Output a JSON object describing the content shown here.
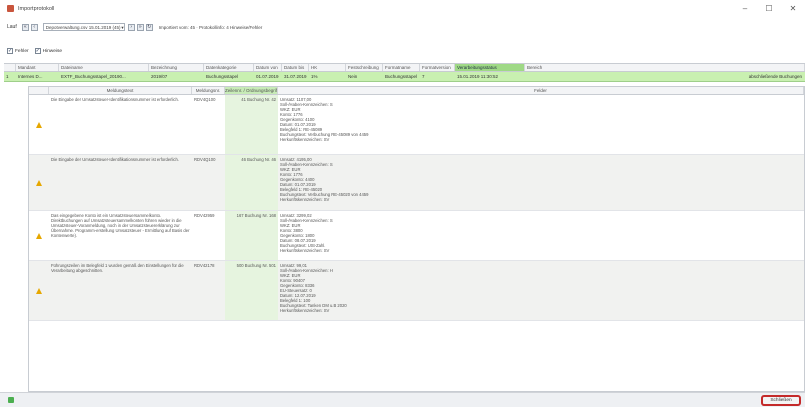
{
  "window": {
    "title": "Importprotokoll",
    "controls": [
      "–",
      "☐",
      "✕"
    ]
  },
  "toolbar": {
    "lauf_label": "Lauf",
    "lauf_value": "Depotverwaltung.csv 15.01.2019 (45)",
    "summary": "Importiert vom: 45 · Protokollinfo: 4 Hinweise/Fehler"
  },
  "filters": [
    {
      "label": "Fehler",
      "checked": true
    },
    {
      "label": "Hinweise",
      "checked": true
    }
  ],
  "grid": {
    "columns": [
      "",
      "Mandant",
      "Dateiname",
      "Bezeichnung",
      "Datenkategorie",
      "Datum von",
      "Datum bis",
      "HK",
      "Festschreibung",
      "Formatname",
      "Formatversion",
      "Verarbeitungsstatus",
      "Bereich"
    ],
    "row": {
      "warn": "1",
      "cells": [
        "Internes D...",
        "EXTF_Buchungsstapel_20190...",
        "2019/07",
        "Buchungsstapel",
        "01.07.2019",
        "31.07.2019",
        "1%",
        "Nein",
        "Buchungsstapel",
        "7",
        "15.01.2019 11:30:52"
      ],
      "bereich": "abschließende Buchungen"
    }
  },
  "detail": {
    "columns": [
      "",
      "Meldungstext",
      "Meldungsnr.",
      "Zeilennr. / Ordnungsbegriff",
      "Felder"
    ],
    "rows": [
      {
        "text": "Die Eingabe der Umsatzsteuer-Identifikationsnummer ist erforderlich.",
        "code": "RDV4Q100",
        "ref": "41  Buchung Nr. 42",
        "fields": "Umsatz: 1107,00\nSoll-/Haben-Kennzeichen: S\nWKZ: EUR\nKonto: 1776\nGegenkonto: 4100\nDatum: 01.07.2019\nBelegfeld 1: RE-45089\nBuchungstext: Verbuchung RE-45089 von 4459\nHerkunftskennzeichen: SV"
      },
      {
        "text": "Die Eingabe der Umsatzsteuer-Identifikationsnummer ist erforderlich.",
        "code": "RDV4Q100",
        "ref": "46  Buchung Nr. 46",
        "fields": "Umsatz: 4195,00\nSoll-/Haben-Kennzeichen: S\nWKZ: EUR\nKonto: 1776\nGegenkonto: 4400\nDatum: 01.07.2019\nBelegfeld 1: RE-45020\nBuchungstext: Verbuchung RE-45020 von 4459\nHerkunftskennzeichen: SV"
      },
      {
        "text": "Das eingegebene Konto ist ein Umsatzsteuersammelkonto. Direktbuchungen auf Umsatzsteuersammelkonten führen wieder in die Umsatzsteuer-Voranmeldung, noch in der Umsatzsteuererklärung zur Übernahme. Programm-erstellung Umsatzsteuer - Ermittlung auf Basis der Kontenwerte).",
        "code": "RDV42959",
        "ref": "167  Buchung Nr. 168",
        "fields": "Umsatz: 3299,02\nSoll-/Haben-Kennzeichen: S\nWKZ: EUR\nKonto: 3800\nGegenkonto: 1800\nDatum: 08.07.2019\nBuchungstext: USt-Zahl.\nHerkunftskennzeichen: SV"
      },
      {
        "text": "Führungszeilen im Belegfeld 1 wurden gemäß den Einstellungen für die Verarbeitung abgeschnitten.",
        "code": "RDV42178",
        "ref": "500  Buchung Nr. 501",
        "fields": "Umsatz: 99,01\nSoll-/Haben-Kennzeichen: H\nWKZ: EUR\nKonto: 90407\nGegenkonto: 8336\nEU-Steuersatz: 0\nDatum: 12.07.2019\nBelegfeld 1: 100\nBuchungstext: Tanken DM u.B 2020\nHerkunftskennzeichen: SV"
      }
    ]
  },
  "status": {
    "close_label": "Schließen"
  }
}
